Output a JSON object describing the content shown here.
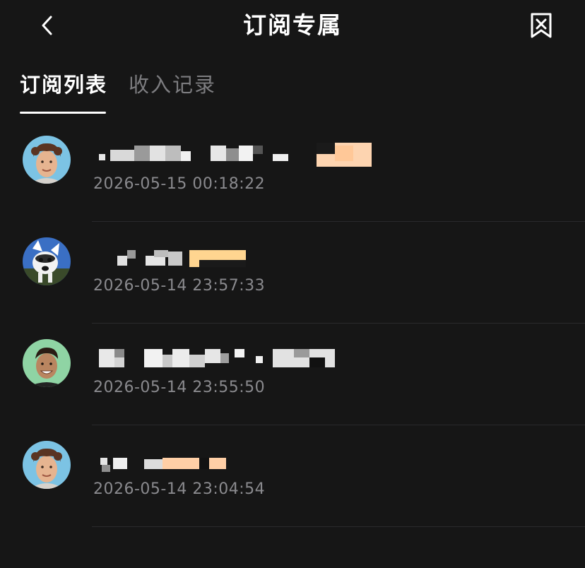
{
  "header": {
    "title": "订阅专属",
    "back_icon": "chevron-left-icon",
    "bookmark_icon": "bookmark-x-icon"
  },
  "tabs": [
    {
      "label": "订阅列表",
      "active": true
    },
    {
      "label": "收入记录",
      "active": false
    }
  ],
  "subscribers": [
    {
      "time": "2026-05-15 00:18:22",
      "avatar": "avatar-man-curly"
    },
    {
      "time": "2026-05-14 23:57:33",
      "avatar": "avatar-dog"
    },
    {
      "time": "2026-05-14 23:55:50",
      "avatar": "avatar-man-smiling"
    },
    {
      "time": "2026-05-14 23:04:54",
      "avatar": "avatar-man-curly"
    }
  ],
  "colors": {
    "background": "#161616",
    "text_primary": "#ffffff",
    "text_secondary": "#8a8a8e",
    "tab_inactive": "#7d7d80",
    "divider": "#2a2a2c"
  }
}
